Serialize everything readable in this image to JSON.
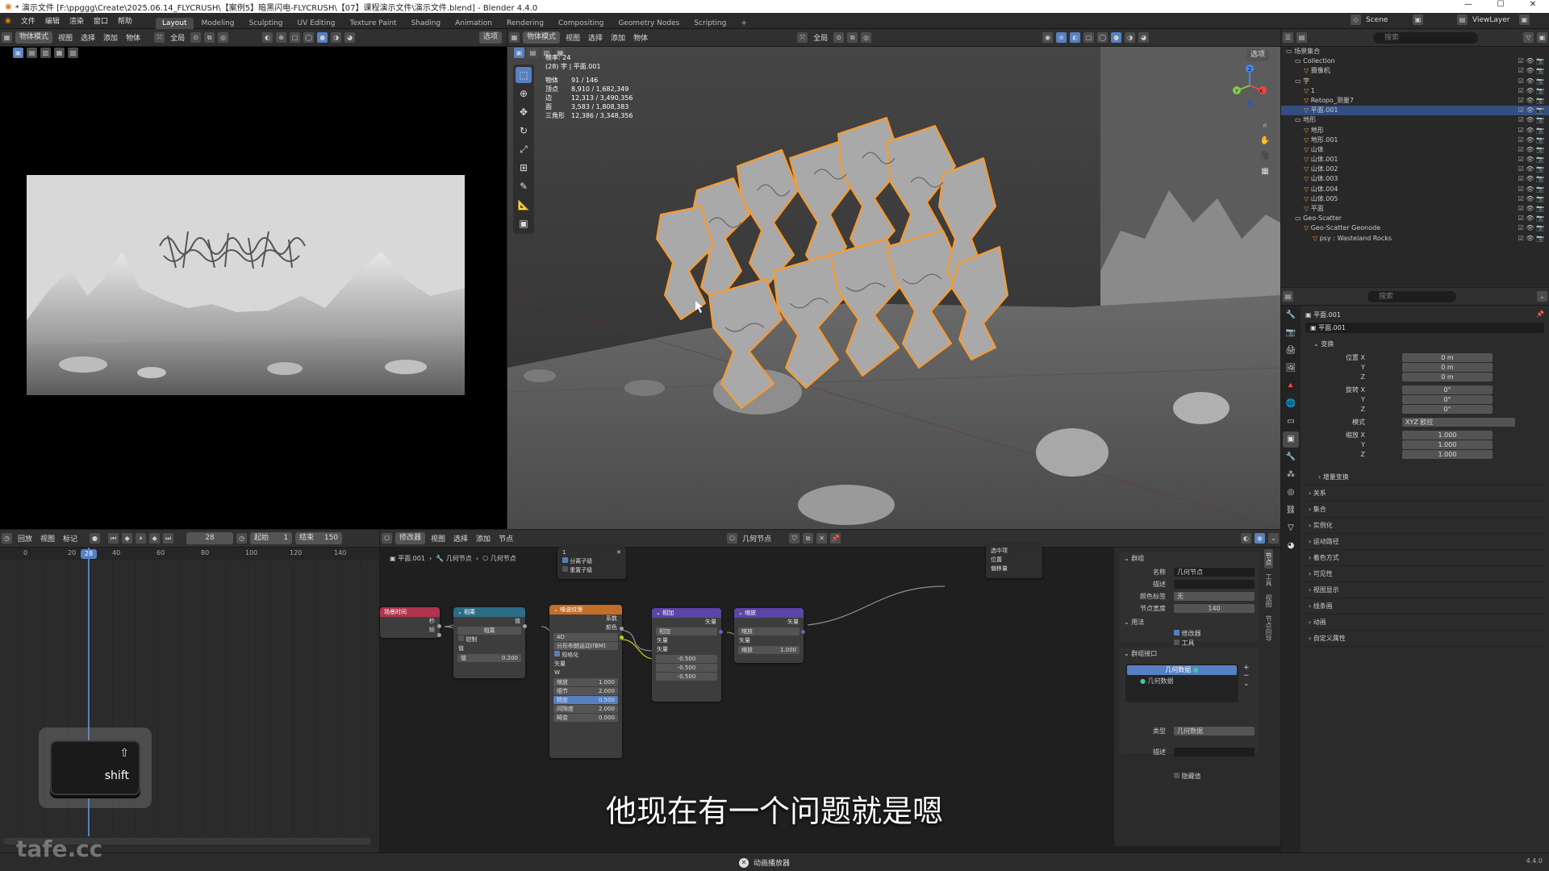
{
  "window": {
    "title": "* 演示文件 [F:\\ppggg\\Create\\2025.06.14_FLYCRUSH\\【案例5】暗黑闪电-FLYCRUSH\\【07】课程演示文件\\演示文件.blend] - Blender 4.4.0",
    "min": "—",
    "max": "☐",
    "close": "✕"
  },
  "menu": {
    "items": [
      "文件",
      "编辑",
      "渲染",
      "窗口",
      "帮助"
    ]
  },
  "workspaces": [
    "Layout",
    "Modeling",
    "Sculpting",
    "UV Editing",
    "Texture Paint",
    "Shading",
    "Animation",
    "Rendering",
    "Compositing",
    "Geometry Nodes",
    "Scripting",
    "+"
  ],
  "topright": {
    "scene": "Scene",
    "viewlayer": "ViewLayer"
  },
  "left_view": {
    "mode": "物体模式",
    "menus": [
      "视图",
      "选择",
      "添加",
      "物体"
    ],
    "transform": "全局",
    "options": "选项"
  },
  "main_view": {
    "mode": "物体模式",
    "menus": [
      "视图",
      "选择",
      "添加",
      "物体"
    ],
    "transform": "全局",
    "options": "选项",
    "stats": {
      "fps": "帧率: 24",
      "object": "(28) 字 | 平面.001",
      "rows": [
        {
          "k": "物体",
          "v": "91 / 146"
        },
        {
          "k": "顶点",
          "v": "8,910 / 1,682,349"
        },
        {
          "k": "边",
          "v": "12,313 / 3,490,356"
        },
        {
          "k": "面",
          "v": "3,583 / 1,808,383"
        },
        {
          "k": "三角形",
          "v": "12,386 / 3,348,356"
        }
      ]
    },
    "gizmo": {
      "x": "X",
      "y": "Y",
      "z": "Z"
    }
  },
  "outliner": {
    "search": "搜索",
    "root": "场景集合",
    "rows": [
      {
        "label": "Collection",
        "indent": 1,
        "sel": false
      },
      {
        "label": "摄像机",
        "indent": 2,
        "sel": false
      },
      {
        "label": "字",
        "indent": 1,
        "sel": false
      },
      {
        "label": "1",
        "indent": 2,
        "sel": false
      },
      {
        "label": "Retopo_测量7",
        "indent": 2,
        "sel": false
      },
      {
        "label": "平面.001",
        "indent": 2,
        "sel": true
      },
      {
        "label": "地形",
        "indent": 1,
        "sel": false
      },
      {
        "label": "地形",
        "indent": 2,
        "sel": false
      },
      {
        "label": "地形.001",
        "indent": 2,
        "sel": false
      },
      {
        "label": "山体",
        "indent": 2,
        "sel": false
      },
      {
        "label": "山体.001",
        "indent": 2,
        "sel": false
      },
      {
        "label": "山体.002",
        "indent": 2,
        "sel": false
      },
      {
        "label": "山体.003",
        "indent": 2,
        "sel": false
      },
      {
        "label": "山体.004",
        "indent": 2,
        "sel": false
      },
      {
        "label": "山体.005",
        "indent": 2,
        "sel": false
      },
      {
        "label": "平面",
        "indent": 2,
        "sel": false
      },
      {
        "label": "Geo-Scatter",
        "indent": 1,
        "sel": false
      },
      {
        "label": "Geo-Scatter Geonode",
        "indent": 2,
        "sel": false
      },
      {
        "label": "psy : Wasteland Rocks",
        "indent": 3,
        "sel": false
      }
    ]
  },
  "properties": {
    "search": "搜索",
    "object_name": "平面.001",
    "data_name": "平面.001",
    "transform_header": "变换",
    "rows": [
      {
        "label": "位置 X",
        "value": "0 m"
      },
      {
        "label": "Y",
        "value": "0 m"
      },
      {
        "label": "Z",
        "value": "0 m"
      },
      {
        "label": "旋转 X",
        "value": "0°"
      },
      {
        "label": "Y",
        "value": "0°"
      },
      {
        "label": "Z",
        "value": "0°"
      },
      {
        "label": "模式",
        "value": "XYZ 欧拉"
      },
      {
        "label": "缩放 X",
        "value": "1.000"
      },
      {
        "label": "Y",
        "value": "1.000"
      },
      {
        "label": "Z",
        "value": "1.000"
      }
    ],
    "panels": [
      "增量变换",
      "关系",
      "集合",
      "实例化",
      "运动路径",
      "着色方式",
      "可见性",
      "视图显示",
      "线条画",
      "动画",
      "自定义属性"
    ]
  },
  "timeline": {
    "menus": [
      "回放",
      "视图",
      "标记"
    ],
    "frame": "28",
    "start_label": "起始",
    "start": "1",
    "end_label": "结束",
    "end": "150",
    "ticks": [
      "0",
      "20",
      "40",
      "60",
      "80",
      "100",
      "120",
      "140"
    ],
    "current": "28"
  },
  "node_editor": {
    "editor": "修改器",
    "menus": [
      "视图",
      "选择",
      "添加",
      "节点"
    ],
    "group": "几何节点",
    "breadcrumb": [
      "平面.001",
      "几何节点",
      "几何节点"
    ],
    "modifier_panel": {
      "label": "1",
      "cb1": "分离子级",
      "cb2": "重置子级"
    },
    "output_node": {
      "rows": [
        "选中项",
        "位置",
        "偏移量"
      ]
    },
    "nodes": {
      "scene_time": {
        "title": "场景时间",
        "rows": [
          "秒",
          "帧"
        ]
      },
      "math": {
        "title": "相乘",
        "op": "相乘",
        "clamp": "钳制",
        "val_label": "值",
        "val": "0.200",
        "out": "值"
      },
      "noise": {
        "title": "噪波纹理",
        "dim": "4D",
        "basis": "分形布朗运动(fBM)",
        "normalize": "规格化",
        "out1": "系数",
        "out2": "颜色",
        "in1": "矢量",
        "in2": "W",
        "scale_l": "缩放",
        "scale": "1.000",
        "detail_l": "细节",
        "detail": "2.000",
        "rough_l": "糙度",
        "rough": "0.500",
        "lac_l": "间隙度",
        "lac": "2.000",
        "dist_l": "畸变",
        "dist": "0.000"
      },
      "subtract": {
        "title": "相加",
        "op": "相加",
        "out": "矢量",
        "in1": "矢量",
        "in2": "矢量",
        "v1": "-0.500",
        "v2": "-0.500",
        "v3": "-0.500"
      },
      "scale": {
        "title": "缩放",
        "op": "缩放",
        "out": "矢量",
        "in": "矢量",
        "s_l": "缩放",
        "s": "1.000"
      }
    }
  },
  "node_sidebar": {
    "group_header": "群组",
    "name_l": "名称",
    "name": "几何节点",
    "desc_l": "描述",
    "color_l": "颜色标签",
    "color": "无",
    "width_l": "节点宽度",
    "width": "140",
    "usage_header": "用法",
    "modifier": "修改器",
    "tool": "工具",
    "interface_header": "群组接口",
    "item1": "几何数据",
    "item2": "几何数据",
    "type_l": "类型",
    "type": "几何数据",
    "desc2_l": "描述",
    "hide": "隐藏值",
    "tabs": [
      "节点",
      "工具",
      "视图",
      "节点向导"
    ]
  },
  "key_overlay": {
    "key": "shift",
    "glyph": "⇧"
  },
  "subtitle": "他现在有一个问题就是嗯",
  "status": {
    "msg": "动画播放器",
    "version": "4.4.0"
  },
  "watermark": "tafe.cc",
  "colors": {
    "accent": "#5680c2",
    "selection": "#ff9a28",
    "node_vector": "#6363c7",
    "node_input": "#b0344d",
    "node_math": "#2c6d86",
    "node_texture": "#c36d27"
  }
}
